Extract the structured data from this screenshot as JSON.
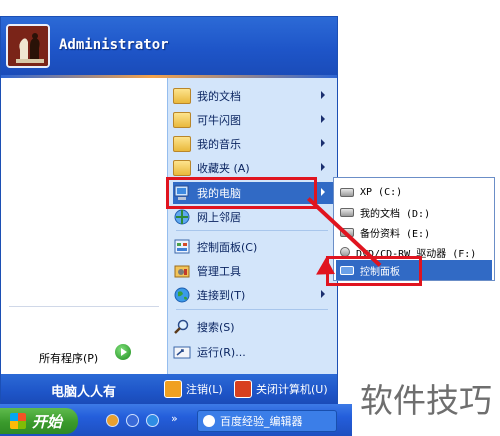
{
  "user": {
    "name": "Administrator"
  },
  "right_menu": {
    "items": [
      {
        "label": "我的文档",
        "icon": "my-documents-icon",
        "has_submenu": true
      },
      {
        "label": "可牛闪图",
        "icon": "folder-icon",
        "has_submenu": true
      },
      {
        "label": "我的音乐",
        "icon": "folder-icon",
        "has_submenu": true
      },
      {
        "label": "收藏夹 (A)",
        "icon": "folder-icon",
        "has_submenu": true
      },
      {
        "label": "我的电脑",
        "icon": "my-computer-icon",
        "has_submenu": true,
        "highlighted": true
      },
      {
        "label": "网上邻居",
        "icon": "network-icon",
        "has_submenu": false
      },
      {
        "label": "控制面板(C)",
        "icon": "control-panel-icon",
        "has_submenu": false
      },
      {
        "label": "管理工具",
        "icon": "admin-tools-icon",
        "has_submenu": true
      },
      {
        "label": "连接到(T)",
        "icon": "globe-icon",
        "has_submenu": true
      },
      {
        "label": "搜索(S)",
        "icon": "search-icon",
        "has_submenu": false
      },
      {
        "label": "运行(R)...",
        "icon": "run-icon",
        "has_submenu": false
      }
    ]
  },
  "all_programs": "所有程序(P)",
  "footer": {
    "left_text": "电脑人人有",
    "logoff": "注销(L)",
    "shutdown": "关闭计算机(U)"
  },
  "flyout": {
    "items": [
      {
        "label": "XP (C:)"
      },
      {
        "label": "我的文档 (D:)"
      },
      {
        "label": "备份资料 (E:)"
      },
      {
        "label": "DVD/CD-RW 驱动器 (F:)"
      },
      {
        "label": "控制面板",
        "highlighted": true
      }
    ]
  },
  "taskbar": {
    "start_label": "开始",
    "task_label": "百度经验_编辑器"
  },
  "watermark": "软件技巧",
  "colors": {
    "accent_blue": "#1e55c8",
    "highlight": "#316ac5",
    "annotation_red": "#e0141f",
    "start_green": "#3a9a2c"
  }
}
